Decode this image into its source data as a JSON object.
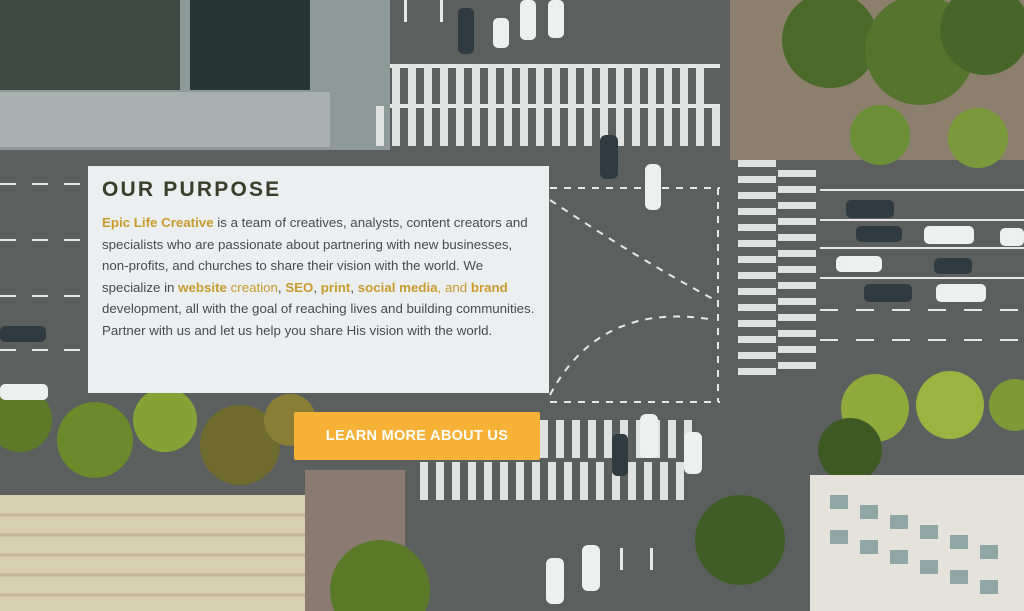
{
  "purpose": {
    "heading": "OUR PURPOSE",
    "body": {
      "brand": "Epic Life Creative",
      "p1": " is a team of creatives, analysts, content creators and specialists who are passionate about partnering with new businesses, non-profits, and churches to share their vision with the world. We specialize in ",
      "website": "website",
      "creation": " creation",
      "comma1": ", ",
      "seo": "SEO",
      "comma2": ", ",
      "print": "print",
      "comma3": ", ",
      "social": "social media",
      "and": ", and ",
      "brandword": "brand",
      "p2": " development, all with the goal of reaching lives and building communities. Partner with us and let us help you share His vision with the world."
    }
  },
  "cta": {
    "label": "LEARN MORE ABOUT US"
  },
  "colors": {
    "accent": "#c99a2e",
    "button": "#f6b136",
    "card": "#eceff0"
  }
}
